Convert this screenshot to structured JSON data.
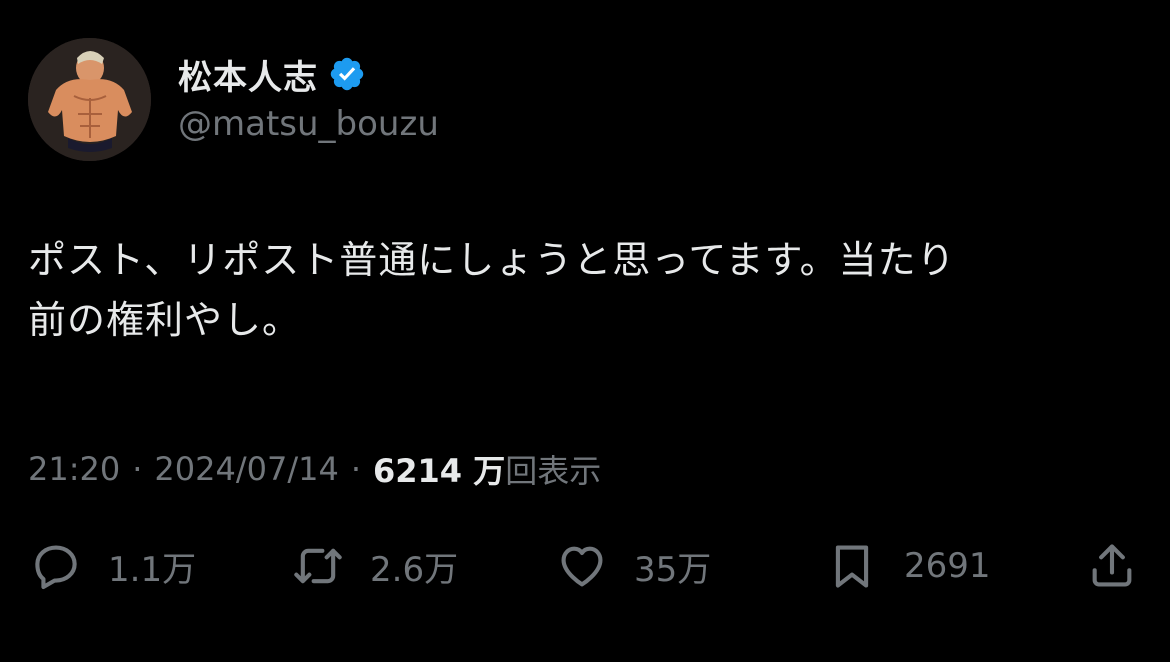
{
  "author": {
    "name": "松本人志",
    "handle": "@matsu_bouzu",
    "verified": true,
    "verified_color": "#1d9bf0"
  },
  "tweet": {
    "text_line1": "ポスト、リポスト普通にしょうと思ってます。当たり",
    "text_line2": "前の権利やし。"
  },
  "meta": {
    "time": "21:20",
    "separator": "·",
    "date": "2024/07/14",
    "views_count": "6214 万",
    "views_label": "回表示"
  },
  "actions": {
    "reply": {
      "icon": "reply-icon",
      "count": "1.1万"
    },
    "repost": {
      "icon": "repost-icon",
      "count": "2.6万"
    },
    "like": {
      "icon": "heart-icon",
      "count": "35万"
    },
    "bookmark": {
      "icon": "bookmark-icon",
      "count": "2691"
    },
    "share": {
      "icon": "share-icon"
    }
  }
}
